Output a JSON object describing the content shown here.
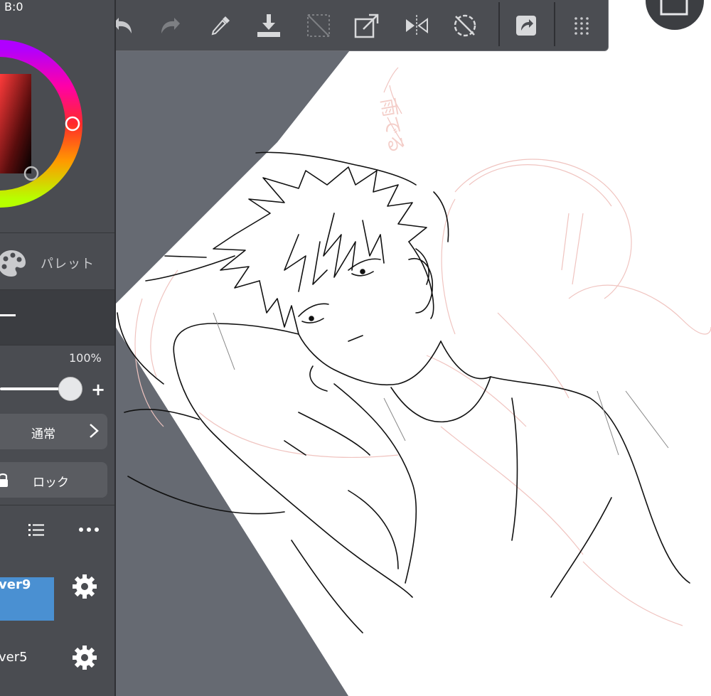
{
  "color": {
    "rgb_readout": "B:0",
    "hue_accent": "#ff00aa"
  },
  "palette": {
    "label": "パレット",
    "icon": "palette-icon"
  },
  "layer_props": {
    "opacity": "100%",
    "opacity_fraction": 1.0,
    "plus": "+",
    "blend_mode": "通常",
    "lock_label": "ロック"
  },
  "layers": [
    {
      "label": "ver9",
      "selected": true
    },
    {
      "label": "ver5",
      "selected": false
    }
  ],
  "toolbar": {
    "items": [
      "undo-icon",
      "redo-icon",
      "eyedropper-icon",
      "save-icon",
      "deselect-icon",
      "transform-icon",
      "flip-icon",
      "rotate-reset-icon",
      "share-icon",
      "grid-icon"
    ]
  },
  "canvas": {
    "sketch_note": "雨でる"
  }
}
